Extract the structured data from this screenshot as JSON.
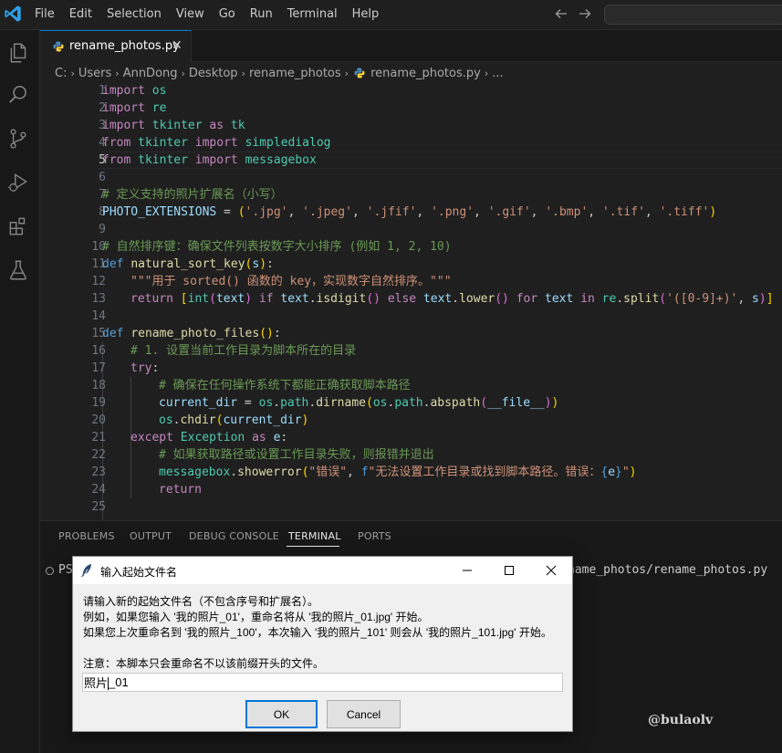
{
  "titlebar": {
    "menu": [
      "File",
      "Edit",
      "Selection",
      "View",
      "Go",
      "Run",
      "Terminal",
      "Help"
    ],
    "back_icon": "arrow-left",
    "forward_icon": "arrow-right"
  },
  "activity_bar": [
    "explorer-icon",
    "search-icon",
    "source-control-icon",
    "run-debug-icon",
    "extensions-icon",
    "testing-icon"
  ],
  "tab": {
    "label": "rename_photos.py",
    "close": "✕"
  },
  "breadcrumb": [
    "C:",
    "Users",
    "AnnDong",
    "Desktop",
    "rename_photos",
    "rename_photos.py",
    "..."
  ],
  "editor": {
    "active_line": 5,
    "lines": [
      {
        "n": "1"
      },
      {
        "n": "2"
      },
      {
        "n": "3"
      },
      {
        "n": "4"
      },
      {
        "n": "5"
      },
      {
        "n": "6"
      },
      {
        "n": "7"
      },
      {
        "n": "8"
      },
      {
        "n": "9"
      },
      {
        "n": "10"
      },
      {
        "n": "11"
      },
      {
        "n": "12"
      },
      {
        "n": "13"
      },
      {
        "n": "14"
      },
      {
        "n": "15"
      },
      {
        "n": "16"
      },
      {
        "n": "17"
      },
      {
        "n": "18"
      },
      {
        "n": "19"
      },
      {
        "n": "20"
      },
      {
        "n": "21"
      },
      {
        "n": "22"
      },
      {
        "n": "23"
      },
      {
        "n": "24"
      },
      {
        "n": "25"
      }
    ],
    "code": {
      "l1_kw": "import",
      "l1_mod": "os",
      "l2_kw": "import",
      "l2_mod": "re",
      "l3_kw": "import",
      "l3_mod": "tkinter",
      "l3_as": "as",
      "l3_alias": "tk",
      "l4_from": "from",
      "l4_mod": "tkinter",
      "l4_imp": "import",
      "l4_name": "simpledialog",
      "l5_from": "from",
      "l5_mod": "tkinter",
      "l5_imp": "import",
      "l5_name": "messagebox",
      "l7_comment": "# 定义支持的照片扩展名（小写）",
      "l8_var": "PHOTO_EXTENSIONS",
      "l8_eq": " = ",
      "l8_exts": [
        "'.jpg'",
        "'.jpeg'",
        "'.jfif'",
        "'.png'",
        "'.gif'",
        "'.bmp'",
        "'.tif'",
        "'.tiff'"
      ],
      "l10_comment": "# 自然排序键：确保文件列表按数字大小排序 (例如 1, 2, 10)",
      "l11_def": "def",
      "l11_name": "natural_sort_key",
      "l11_param": "s",
      "l12_doc": "\"\"\"用于 sorted() 函数的 key，实现数字自然排序。\"\"\"",
      "l13_ret": "return",
      "l13_int": "int",
      "l13_text": "text",
      "l13_if": "if",
      "l13_isdigit": "isdigit",
      "l13_else": "else",
      "l13_lower": "lower",
      "l13_for": "for",
      "l13_in": "in",
      "l13_re": "re",
      "l13_split": "split",
      "l13_regex": "'([0-9]+)'",
      "l13_s": "s",
      "l15_def": "def",
      "l15_name": "rename_photo_files",
      "l16_comment": "# 1. 设置当前工作目录为脚本所在的目录",
      "l17_try": "try",
      "l18_comment": "# 确保在任何操作系统下都能正确获取脚本路径",
      "l19_var": "current_dir",
      "l19_os": "os",
      "l19_path": "path",
      "l19_dirname": "dirname",
      "l19_path2": "path",
      "l19_abspath": "abspath",
      "l19_file": "__file__",
      "l20_os": "os",
      "l20_chdir": "chdir",
      "l20_arg": "current_dir",
      "l21_except": "except",
      "l21_exc": "Exception",
      "l21_as": "as",
      "l21_e": "e",
      "l22_comment": "# 如果获取路径或设置工作目录失败，则报错并退出",
      "l23_mb": "messagebox",
      "l23_fn": "showerror",
      "l23_s1": "\"错误\"",
      "l23_f": "f",
      "l23_s2a": "\"无法设置工作目录或找到脚本路径。错误：",
      "l23_e": "e",
      "l23_s2b": "\"",
      "l24_ret": "return"
    }
  },
  "panel": {
    "tabs": [
      "PROBLEMS",
      "OUTPUT",
      "DEBUG CONSOLE",
      "TERMINAL",
      "PORTS"
    ],
    "active_tab": "TERMINAL",
    "terminal_prompt": "PS",
    "terminal_tail": "name_photos/rename_photos.py",
    "watermark": "@bulaolv"
  },
  "dialog": {
    "title": "输入起始文件名",
    "body": "请输入新的起始文件名（不包含序号和扩展名）。\n例如，如果您输入 '我的照片_01'，重命名将从 '我的照片_01.jpg' 开始。\n如果您上次重命名到 '我的照片_100'，本次输入 '我的照片_101' 则会从 '我的照片_101.jpg' 开始。\n\n注意：本脚本只会重命名不以该前缀开头的文件。",
    "input_before_caret": "照片",
    "input_after_caret": "_01",
    "ok_label": "OK",
    "cancel_label": "Cancel"
  },
  "colors": {
    "accent": "#0078d4",
    "keyword": "#c586c0",
    "string": "#ce9178",
    "comment": "#6a9955",
    "function": "#dcdcaa",
    "variable": "#9cdcfe"
  }
}
